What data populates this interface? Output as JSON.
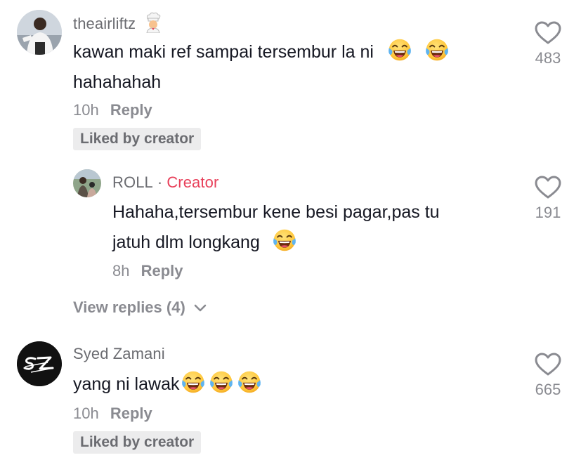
{
  "comments": [
    {
      "username": "theairliftz",
      "badge_icon": "chef-emoji",
      "text_line1": "kawan maki ref sampai tersembur la ni",
      "text_line2": "hahahahah",
      "emoji_icon": "tears-of-joy-emoji",
      "time": "10h",
      "reply_label": "Reply",
      "liked_label": "Liked by creator",
      "likes": "483"
    },
    {
      "username": "ROLL",
      "separator": "·",
      "creator_label": "Creator",
      "text_line1": "Hahaha,tersembur kene besi pagar,pas tu",
      "text_line2": "jatuh dlm longkang",
      "emoji_icon": "tears-of-joy-emoji",
      "time": "8h",
      "reply_label": "Reply",
      "likes": "191"
    },
    {
      "username": "Syed Zamani",
      "avatar_initials": "SZ",
      "text_line1": "yang ni lawak",
      "emoji_icon": "tears-of-joy-emoji",
      "time": "10h",
      "reply_label": "Reply",
      "liked_label": "Liked by creator",
      "likes": "665"
    }
  ],
  "view_replies_label": "View replies (4)",
  "colors": {
    "creator_accent": "#e8405a",
    "muted_text": "#8a8b91",
    "liked_badge_bg": "#ececed"
  }
}
